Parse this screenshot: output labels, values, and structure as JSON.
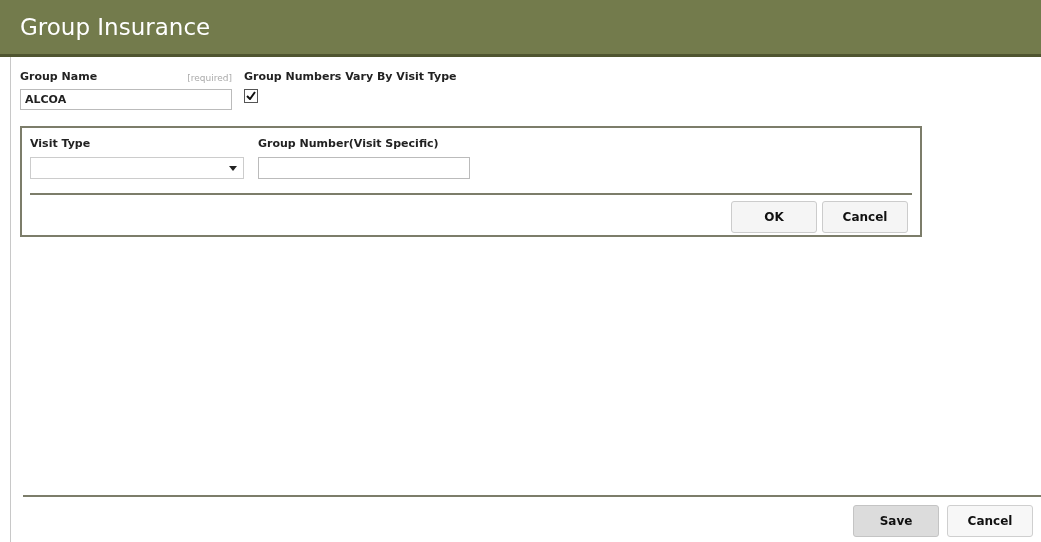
{
  "header": {
    "title": "Group Insurance"
  },
  "group_name": {
    "label": "Group Name",
    "hint": "[required]",
    "value": "ALCOA"
  },
  "vary_by_visit_type": {
    "label": "Group Numbers Vary By Visit Type",
    "checked": true
  },
  "visit_panel": {
    "visit_type": {
      "label": "Visit Type"
    },
    "group_number": {
      "label": "Group Number(Visit Specific)"
    },
    "buttons": [
      {
        "label": "OK"
      },
      {
        "label": "Cancel"
      }
    ]
  },
  "footer_buttons": [
    {
      "label": "Save",
      "kind": "primary"
    },
    {
      "label": "Cancel",
      "kind": "default"
    }
  ]
}
